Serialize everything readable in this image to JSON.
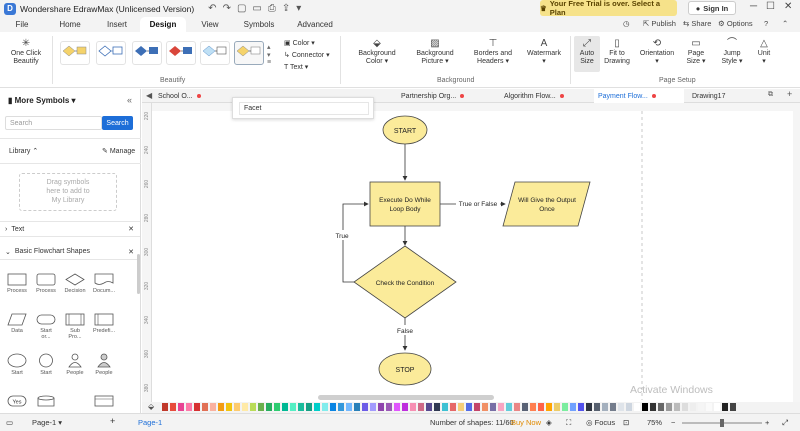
{
  "app": {
    "title": "Wondershare EdrawMax (Unlicensed Version)",
    "logo_letter": "D",
    "trial_text": "Your Free Trial is over. Select a Plan",
    "sign_in": "Sign In"
  },
  "menu": {
    "tabs": [
      "File",
      "Home",
      "Insert",
      "Design",
      "View",
      "Symbols",
      "Advanced"
    ],
    "active": "Design",
    "publish": "Publish",
    "share": "Share",
    "options": "Options"
  },
  "ribbon": {
    "one_click_beautify": [
      "One Click",
      "Beautify"
    ],
    "color": "Color",
    "connector": "Connector",
    "text": "Text",
    "background_color": [
      "Background",
      "Color"
    ],
    "background_picture": [
      "Background",
      "Picture"
    ],
    "borders_headers": [
      "Borders and",
      "Headers"
    ],
    "watermark": "Watermark",
    "auto_size": [
      "Auto",
      "Size"
    ],
    "fit_to_drawing": [
      "Fit to",
      "Drawing"
    ],
    "orientation": "Orientation",
    "page_size": [
      "Page",
      "Size"
    ],
    "jump_style": [
      "Jump",
      "Style"
    ],
    "unit": "Unit",
    "group_beautify": "Beautify",
    "group_background": "Background",
    "group_page_setup": "Page Setup"
  },
  "left_panel": {
    "title": "More Symbols",
    "search_placeholder": "Search",
    "search_button": "Search",
    "library": "Library",
    "manage": "Manage",
    "drag_hint": [
      "Drag symbols",
      "here to add to",
      "My Library"
    ],
    "text_section": "Text",
    "flowchart_section": "Basic Flowchart Shapes",
    "shapes": [
      [
        "Process",
        "Process",
        "Decision",
        "Docum..."
      ],
      [
        "Data",
        "Start or...",
        "Sub Pro...",
        "Predefi..."
      ],
      [
        "Start",
        "Start",
        "People",
        "People"
      ],
      [
        "Yes",
        "",
        "",
        ""
      ]
    ]
  },
  "doc_tabs": [
    "School O...",
    "Partnership Org...",
    "Algorithm Flow...",
    "Payment Flow...",
    "Drawing17"
  ],
  "facet_popup": "Facet",
  "flowchart": {
    "start": "START",
    "process": [
      "Execute Do While",
      "Loop Body"
    ],
    "output": [
      "Will Give the Output",
      "Once"
    ],
    "decision": "Check the Condition",
    "stop": "STOP",
    "label_true_false": "True or False",
    "label_true": "True",
    "label_false": "False"
  },
  "ruler_marks": [
    "220",
    "240",
    "260",
    "280",
    "300",
    "320",
    "340",
    "360",
    "380"
  ],
  "watermark": "Activate Windows",
  "status": {
    "page_selector": "Page-1",
    "page_tab": "Page-1",
    "shapes_count": "Number of shapes: 11/60",
    "buy_now": "Buy Now",
    "focus": "Focus",
    "zoom": "75%"
  },
  "palette_colors": [
    "#c0392b",
    "#e74c3c",
    "#e84393",
    "#fd79a8",
    "#d63031",
    "#e17055",
    "#fab1a0",
    "#f39c12",
    "#f1c40f",
    "#fdcb6e",
    "#ffeaa7",
    "#badc58",
    "#6ab04c",
    "#27ae60",
    "#2ecc71",
    "#00b894",
    "#55efc4",
    "#1abc9c",
    "#16a085",
    "#00cec9",
    "#81ecec",
    "#0984e3",
    "#3498db",
    "#74b9ff",
    "#2980b9",
    "#6c5ce7",
    "#a29bfe",
    "#8e44ad",
    "#9b59b6",
    "#e056fd",
    "#be2edd",
    "#f78fb3",
    "#cf6a87",
    "#574b90",
    "#303952",
    "#3dc1d3",
    "#e66767",
    "#f5cd79",
    "#546de5",
    "#c44569",
    "#f19066",
    "#786fa6",
    "#f8a5c2",
    "#63cdda",
    "#ea8685",
    "#596275",
    "#ff7f50",
    "#ff6348",
    "#ffa502",
    "#eccc68",
    "#7bed9f",
    "#70a1ff",
    "#5352ed",
    "#2f3542",
    "#57606f",
    "#a4b0be",
    "#747d8c",
    "#dfe4ea",
    "#ced6e0",
    "#ffffff",
    "#000000",
    "#333333",
    "#666666",
    "#999999",
    "#bbbbbb",
    "#dddddd",
    "#eeeeee",
    "#f5f5f5",
    "#fafafa",
    "#ffffff",
    "#222222",
    "#444444"
  ]
}
